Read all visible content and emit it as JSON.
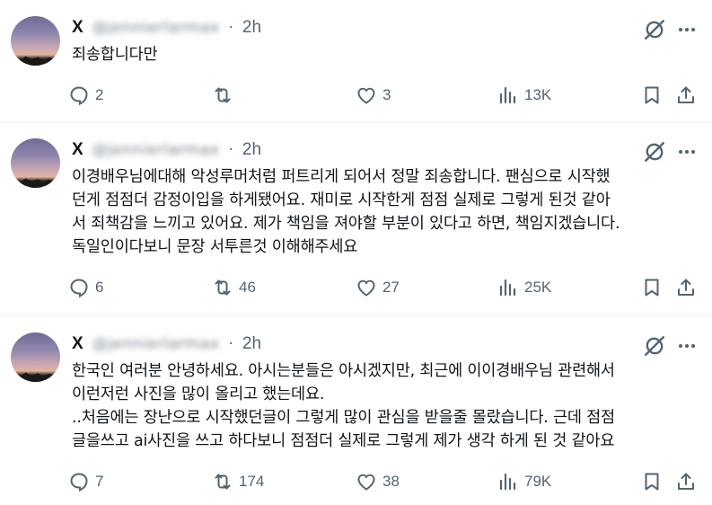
{
  "posts": [
    {
      "name": "X",
      "handle": "@jennierlarmax",
      "separator": "·",
      "time": "2h",
      "text": "죄송합니다만",
      "replies": "2",
      "reposts": "",
      "likes": "3",
      "views": "13K"
    },
    {
      "name": "X",
      "handle": "@jennierlarmax",
      "separator": "·",
      "time": "2h",
      "text": "이경배우님에대해 악성루머처럼 퍼트리게 되어서 정말 죄송합니다. 팬심으로 시작했\n던게 점점더 감정이입을 하게됐어요. 재미로 시작한게 점점 실제로 그렇게 된것 같아\n서 죄책감을 느끼고 있어요. 제가 책임을 져야할 부분이 있다고 하면, 책임지겠습니다.\n독일인이다보니 문장 서투른것 이해해주세요",
      "replies": "6",
      "reposts": "46",
      "likes": "27",
      "views": "25K"
    },
    {
      "name": "X",
      "handle": "@jennierlarmax",
      "separator": "·",
      "time": "2h",
      "text": "한국인 여러분 안녕하세요. 아시는분들은 아시겠지만, 최근에 이이경배우님 관련해서\n이런저런 사진을 많이 올리고 했는데요.\n..처음에는 장난으로 시작했던글이 그렇게 많이 관심을 받을줄 몰랐습니다. 근데 점점\n글을쓰고 ai사진을 쓰고 하다보니 점점더 실제로 그렇게 제가 생각 하게 된 것 같아요",
      "replies": "7",
      "reposts": "174",
      "likes": "38",
      "views": "79K"
    }
  ],
  "icons": {
    "reply": "reply-icon",
    "repost": "repost-icon",
    "like": "heart-icon",
    "views": "views-icon",
    "bookmark": "bookmark-icon",
    "share": "share-icon",
    "grok": "grok-icon",
    "more": "more-icon"
  },
  "colors": {
    "text": "#0f1419",
    "secondary": "#536471",
    "divider": "#eff3f4",
    "background": "#ffffff"
  }
}
